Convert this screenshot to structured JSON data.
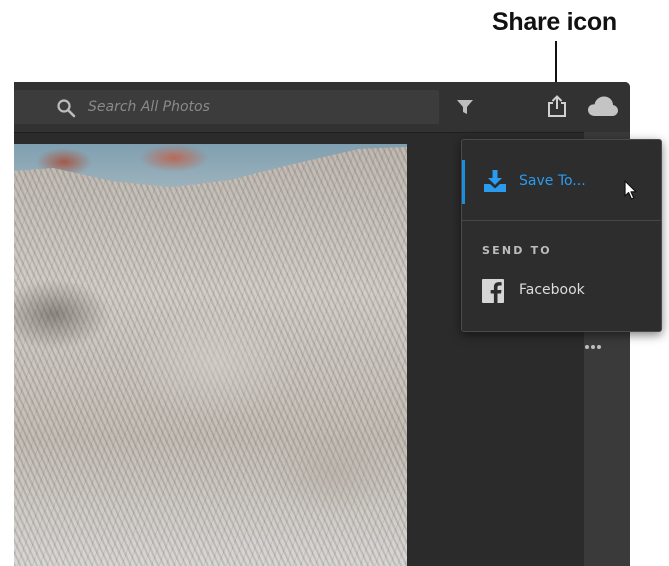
{
  "callout": {
    "label": "Share icon"
  },
  "toolbar": {
    "search_placeholder": "Search All Photos",
    "icons": [
      "search-icon",
      "filter-icon",
      "share-icon",
      "cloud-icon"
    ]
  },
  "share_menu": {
    "save_label": "Save To...",
    "send_to_heading": "SEND TO",
    "facebook_label": "Facebook"
  },
  "colors": {
    "accent": "#1a8fe0",
    "panel": "#2d2d2d",
    "toolbar": "#323232",
    "app_background": "#2b2b2b",
    "callout_text": "#111111"
  }
}
